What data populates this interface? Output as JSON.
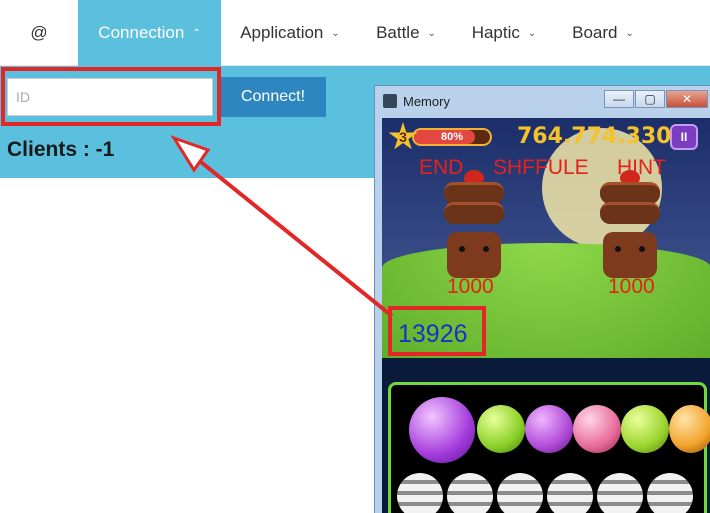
{
  "nav": {
    "brand": "@",
    "items": [
      {
        "label": "Connection",
        "caret": "⌃"
      },
      {
        "label": "Application",
        "caret": "⌄"
      },
      {
        "label": "Battle",
        "caret": "⌄"
      },
      {
        "label": "Haptic",
        "caret": "⌄"
      },
      {
        "label": "Board",
        "caret": "⌄"
      }
    ]
  },
  "connection": {
    "id_placeholder": "ID",
    "id_value": "",
    "connect_label": "Connect!",
    "clients_text": "Clients : -1"
  },
  "window": {
    "title": "Memory",
    "buttons": {
      "minimize": "—",
      "maximize": "▢",
      "close": "✕"
    }
  },
  "game": {
    "level": "3",
    "progress_text": "80%",
    "progress_value": 0.8,
    "score": "764.774.330",
    "pause_symbol": "II",
    "labels": {
      "end": "END",
      "shuffle": "SHFFULE",
      "hint": "HINT"
    },
    "monster_hp_left": "1000",
    "monster_hp_right": "1000",
    "counter": "13926"
  },
  "colors": {
    "accent": "#5bc0de",
    "button": "#2e86c1",
    "annotation": "#e32727",
    "counter": "#1633c8"
  }
}
